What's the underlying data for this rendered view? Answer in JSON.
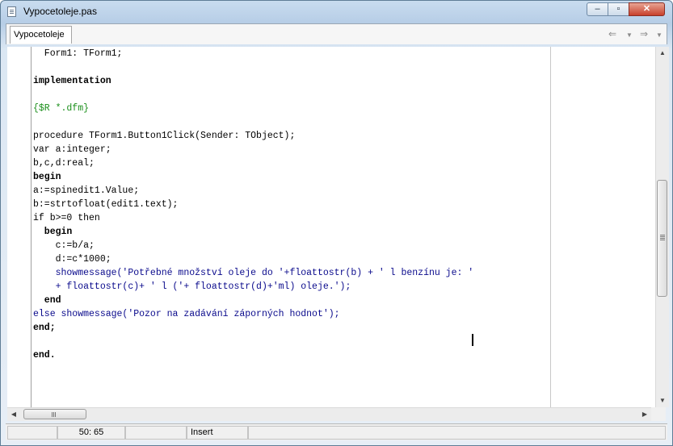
{
  "window": {
    "title": "Vypocetoleje.pas"
  },
  "tabs": [
    {
      "label": "Vypocetoleje"
    }
  ],
  "nav": {
    "back_icon": "arrow-left-icon",
    "forward_icon": "arrow-right-icon"
  },
  "code_lines": [
    "  Form1: TForm1;",
    "",
    "implementation",
    "",
    "{$R *.dfm}",
    "",
    "procedure TForm1.Button1Click(Sender: TObject);",
    "var a:integer;",
    "b,c,d:real;",
    "begin",
    "a:=spinedit1.Value;",
    "b:=strtofloat(edit1.text);",
    "if b>=0 then",
    "  begin",
    "    c:=b/a;",
    "    d:=c*1000;",
    "    showmessage('Potřebné množství oleje do '+floattostr(b) + ' l benzínu je: '",
    "    + floattostr(c)+ ' l ('+ floattostr(d)+'ml) oleje.');",
    "  end",
    "else showmessage('Pozor na zadávání záporných hodnot');",
    "end;",
    "",
    "end."
  ],
  "status": {
    "position": "50: 65",
    "mode": "Insert",
    "modified": ""
  },
  "colors": {
    "keyword": "#000000",
    "string": "#0a0a8c",
    "directive": "#1b8f1b"
  }
}
